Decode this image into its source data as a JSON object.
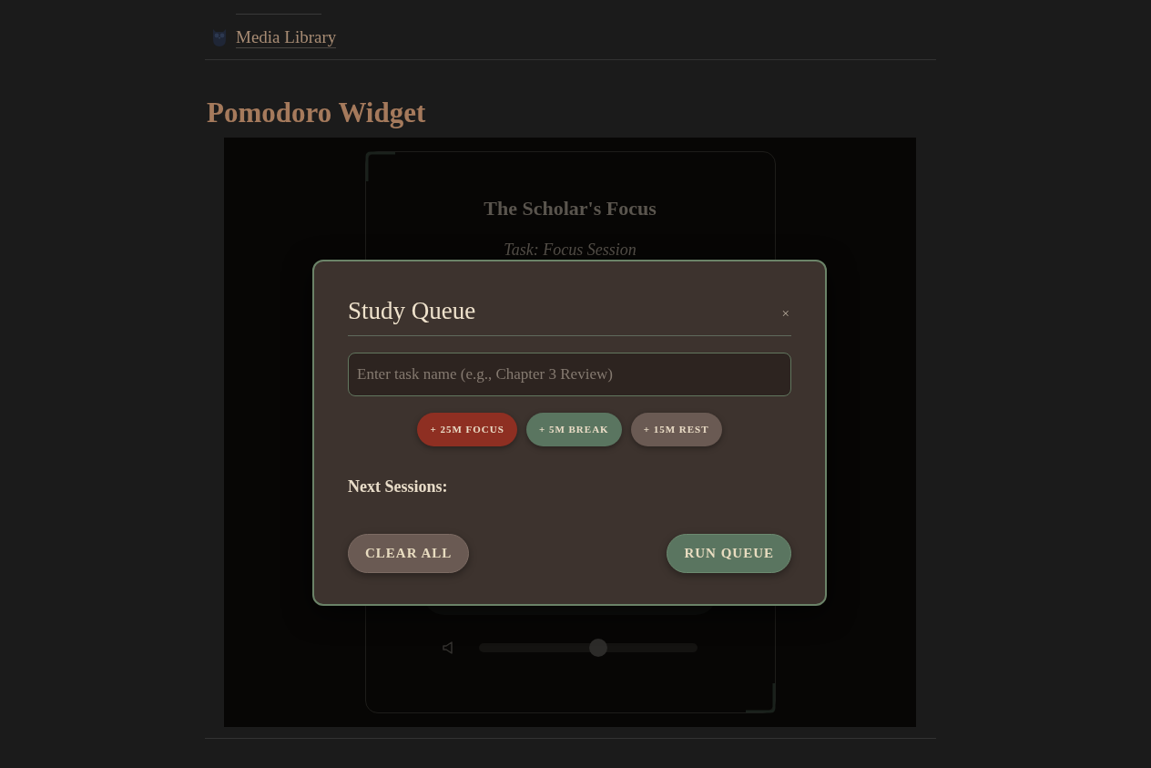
{
  "breadcrumb": {
    "link": "Media Library"
  },
  "heading": "Pomodoro Widget",
  "widget": {
    "title": "The Scholar's Focus",
    "task": "Task: Focus Session",
    "volume": {
      "level": 0.55
    }
  },
  "modal": {
    "title": "Study Queue",
    "close": "×",
    "input": {
      "placeholder": "Enter task name (e.g., Chapter 3 Review)"
    },
    "presets": [
      {
        "label": "+ 25M FOCUS",
        "color": "#8e2f22"
      },
      {
        "label": "+ 5M BREAK",
        "color": "#5a7560"
      },
      {
        "label": "+ 15M REST",
        "color": "#6a5a53"
      }
    ],
    "section_label": "Next Sessions:",
    "actions": [
      {
        "label": "CLEAR ALL",
        "kind": "secondary"
      },
      {
        "label": "RUN QUEUE",
        "kind": "primary"
      }
    ]
  }
}
